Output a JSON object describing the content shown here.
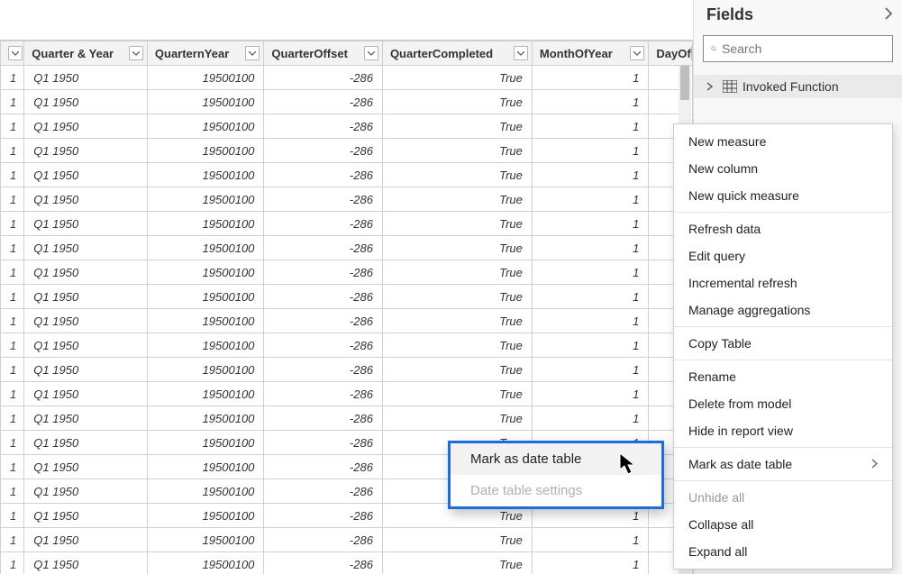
{
  "table": {
    "columns": [
      {
        "key": "qy",
        "label": "Quarter & Year",
        "class": "col-qy",
        "align": "left"
      },
      {
        "key": "qny",
        "label": "QuarternYear",
        "class": "col-qny",
        "align": "right"
      },
      {
        "key": "qoff",
        "label": "QuarterOffset",
        "class": "col-qoff",
        "align": "right"
      },
      {
        "key": "qcomp",
        "label": "QuarterCompleted",
        "class": "col-qcomp",
        "align": "right"
      },
      {
        "key": "moy",
        "label": "MonthOfYear",
        "class": "col-moy",
        "align": "right"
      },
      {
        "key": "doy",
        "label": "DayOf",
        "class": "col-doy",
        "align": "right"
      }
    ],
    "row": {
      "idx": "1",
      "qy": "Q1 1950",
      "qny": "19500100",
      "qoff": "-286",
      "qcomp": "True",
      "moy": "1"
    },
    "rowCount": 21
  },
  "fields": {
    "title": "Fields",
    "searchPlaceholder": "Search",
    "item": "Invoked Function"
  },
  "contextMenu": [
    {
      "type": "item",
      "label": "New measure"
    },
    {
      "type": "item",
      "label": "New column"
    },
    {
      "type": "item",
      "label": "New quick measure"
    },
    {
      "type": "sep"
    },
    {
      "type": "item",
      "label": "Refresh data"
    },
    {
      "type": "item",
      "label": "Edit query"
    },
    {
      "type": "item",
      "label": "Incremental refresh"
    },
    {
      "type": "item",
      "label": "Manage aggregations"
    },
    {
      "type": "sep"
    },
    {
      "type": "item",
      "label": "Copy Table"
    },
    {
      "type": "sep"
    },
    {
      "type": "item",
      "label": "Rename"
    },
    {
      "type": "item",
      "label": "Delete from model"
    },
    {
      "type": "item",
      "label": "Hide in report view"
    },
    {
      "type": "sep"
    },
    {
      "type": "item",
      "label": "Mark as date table",
      "sub": true
    },
    {
      "type": "sep"
    },
    {
      "type": "item",
      "label": "Unhide all",
      "disabled": true
    },
    {
      "type": "item",
      "label": "Collapse all"
    },
    {
      "type": "item",
      "label": "Expand all"
    }
  ],
  "flyout": {
    "items": [
      {
        "label": "Mark as date table",
        "hover": true
      },
      {
        "label": "Date table settings",
        "disabled": true
      }
    ]
  }
}
